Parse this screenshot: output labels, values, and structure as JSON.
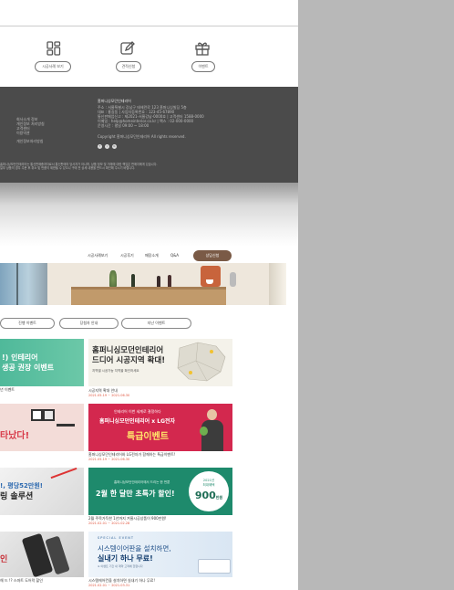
{
  "quick_links": [
    {
      "label": "시공사례 보기",
      "icon": "grid-icon"
    },
    {
      "label": "견적신청",
      "icon": "edit-icon"
    },
    {
      "label": "이벤트",
      "icon": "gift-icon"
    }
  ],
  "footer": {
    "links": [
      "회사소개 정보",
      "개인정보 처리방침",
      "고객센터",
      "이용약관",
      "개인정보처리방침"
    ],
    "company_name": "홈퍼니싱모던인테리어",
    "info_lines": [
      "주소 : 서울특별시 강남구 테헤란로 123 홈퍼니싱빌딩 5층",
      "대표 : 홍길동 | 사업자등록번호 : 123-45-67890",
      "통신판매업신고 : 제2021-서울강남-0000호 | 고객센터 1588-0000",
      "이메일 : help@homeinterior.co.kr | 팩스 : 02-000-0000",
      "운영시간 : 평일 09:00 ~ 18:00"
    ],
    "copyright": "Copyright 홈퍼니싱모던인테리어 All rights reserved.",
    "legal_lines": [
      "홈퍼니싱모던인테리어는 통신판매중개자로서 통신판매의 당사자가 아니며, 상품 정보 및 거래에 대한 책임은 판매자에게 있습니다.",
      "일부 상품의 경우 주문 후 취소 및 반품이 제한될 수 있으니 구매 전 상세 내용을 반드시 확인해 주시기 바랍니다."
    ],
    "social": [
      "f",
      "i",
      "b"
    ]
  },
  "nav": {
    "items": [
      "시공사례보기",
      "시공후기",
      "매장소개",
      "Q&A"
    ],
    "cta": "상담신청"
  },
  "tabs": [
    "진행 이벤트",
    "당첨자 안내",
    "지난 이벤트"
  ],
  "cards": [
    {
      "title_line1": "홈퍼니싱모던인테리어",
      "title_line2": "드디어 시공지역 확대!",
      "desc": "지역별 시공가능 지역을 확인하세요",
      "caption": "시공지역 확대 안내",
      "date": "2021.05.19 ~ 2021.06.30"
    },
    {
      "title_line1": "인테리어 이번 세계로 결정하다",
      "title_line2": "홈퍼니싱모던인테리어 x LG전자",
      "title_line3": "특급이벤트",
      "caption": "홈퍼니싱모던인테리어와 LG전자가 함께하는 특급이벤트!",
      "date": "2021.05.19 ~ 2021.06.30"
    },
    {
      "badge_line1": "2021년",
      "badge_line2": "최대혜택",
      "badge_number": "900",
      "badge_unit": "만원",
      "head_line": "홈퍼니싱모던인테리어에서 드리는 한 번뿐",
      "title": "2월 한 달만 초특가 할인!",
      "caption": "2월 주목가득한 1년까지 겨울시공상품이 900만원!",
      "date": "2021.02.01 ~ 2021.02.28"
    },
    {
      "head_line": "SPECIAL EVENT",
      "title_line1": "시스템이어판을 설치하면,",
      "title_line2": "실내기 하나 무료!",
      "desc": "※ 이벤트 기간 내 계약 고객에 한합니다",
      "caption": "시스템에어컨을 설치하면 실내기 하나 무료!",
      "date": "2021.02.01 ~ 2021.03.31"
    }
  ],
  "left_cards": [
    {
      "text_line1": "!) 인테리어",
      "text_line2": "생공 권장 이벤트",
      "caption": "년 이벤트"
    },
    {
      "text": "타났다!"
    },
    {
      "text_line1": "!, 평당52만원!",
      "text_line2": "링 솔루션",
      "caption": ""
    },
    {
      "text_line1": "",
      "text_line2": "인",
      "caption": "해 드 !? 스마트 도어락 할인"
    }
  ]
}
